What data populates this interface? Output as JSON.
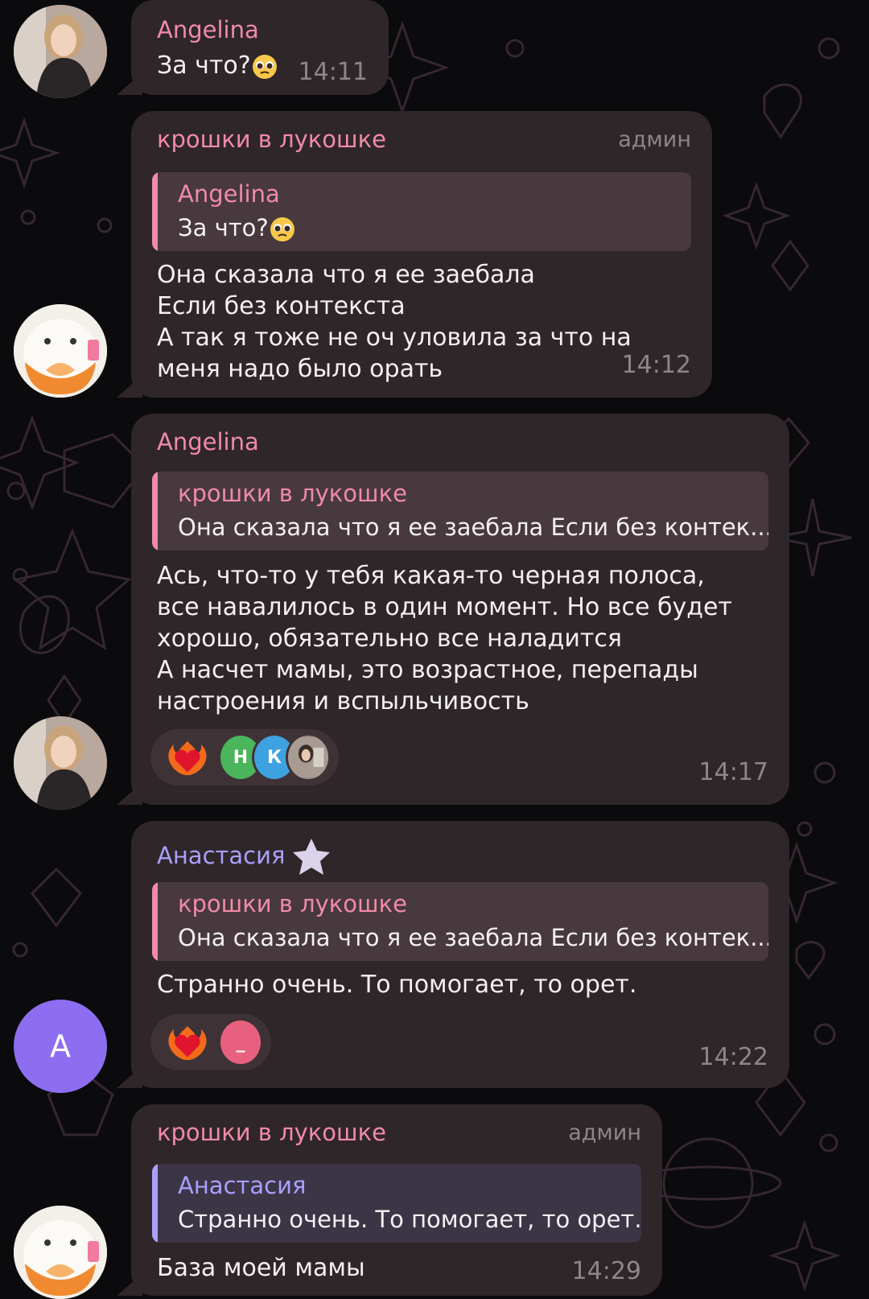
{
  "messages": [
    {
      "sender": "Angelina",
      "text": "За что?",
      "time": "14:11"
    },
    {
      "sender": "крошки в лукошке",
      "role": "админ",
      "reply": {
        "sender": "Angelina",
        "text": "За что?"
      },
      "text": "Она сказала что я ее заебала\nЕсли без контекста\nА так я тоже не оч уловила за что на меня надо было орать",
      "time": "14:12"
    },
    {
      "sender": "Angelina",
      "reply": {
        "sender": "крошки в лукошке",
        "text": "Она сказала что я ее заебала Если без контек..."
      },
      "text": "Ась, что-то у тебя какая-то черная полоса,\nвсе навалилось в один момент. Но все будет\nхорошо, обязательно все наладится\nА насчет мамы, это возрастное, перепады\nнастроения и вспыльчивость",
      "reactions": {
        "emoji": "heart-on-fire",
        "users": [
          "Н",
          "К",
          "photo"
        ]
      },
      "time": "14:17"
    },
    {
      "sender": "Анастасия",
      "reply": {
        "sender": "крошки в лукошке",
        "text": "Она сказала что я ее заебала Если без контек..."
      },
      "text": "Странно очень. То помогает, то орет.",
      "reactions": {
        "emoji": "heart-on-fire",
        "users": [
          "_"
        ]
      },
      "time": "14:22",
      "avatar_letter": "А"
    },
    {
      "sender": "крошки в лукошке",
      "role": "админ",
      "reply": {
        "sender": "Анастасия",
        "text": "Странно очень. То помогает, то орет."
      },
      "text": "База моей мамы",
      "time": "14:29"
    }
  ],
  "colors": {
    "bubble": "#2f2629",
    "pink_name": "#f08aa8",
    "violet_name": "#a9a0ff",
    "meta": "#8f8589"
  }
}
